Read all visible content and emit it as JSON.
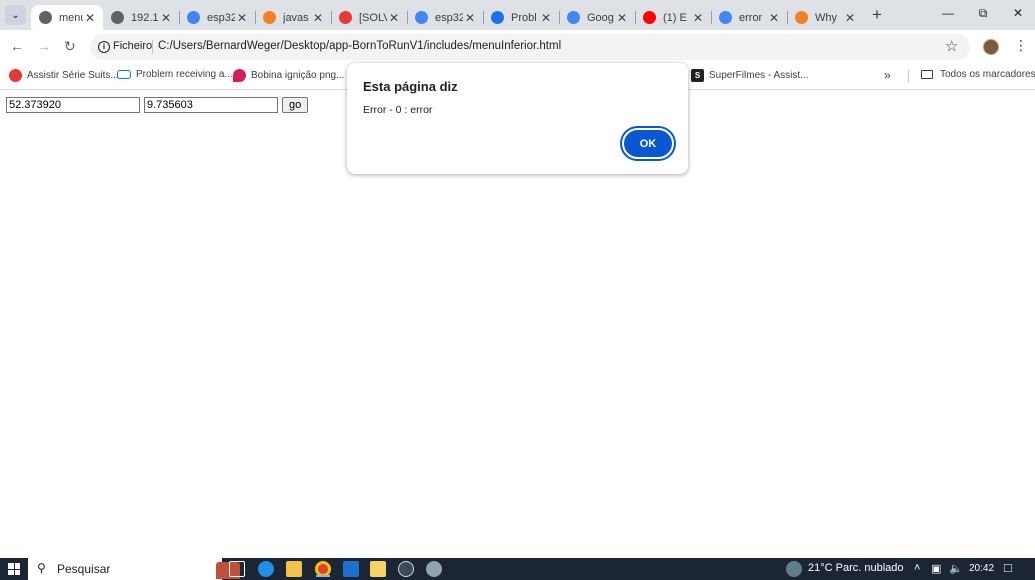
{
  "tabs": [
    {
      "title": "menu",
      "favicon": "globe-icon",
      "color": "#5f6368",
      "active": true
    },
    {
      "title": "192.1",
      "favicon": "globe-icon",
      "color": "#5f6368"
    },
    {
      "title": "esp32",
      "favicon": "google-icon",
      "color": "#4285f4"
    },
    {
      "title": "javas",
      "favicon": "stackoverflow-icon",
      "color": "#f48024"
    },
    {
      "title": "[SOLV",
      "favicon": "rss-icon",
      "color": "#e53935"
    },
    {
      "title": "esp32",
      "favicon": "google-icon",
      "color": "#4285f4"
    },
    {
      "title": "Probl",
      "favicon": "chain-icon",
      "color": "#1a73e8"
    },
    {
      "title": "Goog",
      "favicon": "translate-icon",
      "color": "#4285f4"
    },
    {
      "title": "(1) E",
      "favicon": "youtube-icon",
      "color": "#ff0000"
    },
    {
      "title": "error",
      "favicon": "google-icon",
      "color": "#4285f4"
    },
    {
      "title": "Why",
      "favicon": "stackoverflow-icon",
      "color": "#f48024"
    }
  ],
  "address": {
    "scheme_label": "Ficheiro",
    "url": "C:/Users/BernardWeger/Desktop/app-BornToRunV1/includes/menuInferior.html"
  },
  "bookmarks": [
    {
      "label": "Assistir Série Suits...",
      "color": "#e53935"
    },
    {
      "label": "Problem receiving a...",
      "color": "#1a73e8"
    },
    {
      "label": "Bobina ignição png...",
      "color": "#d81b60"
    },
    {
      "label": "SuperFilmes - Assist...",
      "color": "#202124"
    }
  ],
  "all_bookmarks_label": "Todos os marcadores",
  "form": {
    "lat": "52.373920",
    "lng": "9.735603",
    "go_label": "go"
  },
  "dialog": {
    "title": "Esta página diz",
    "message": "Error - 0 : error",
    "ok_label": "OK"
  },
  "taskbar": {
    "search_label": "Pesquisar",
    "weather": "21°C  Parc. nublado",
    "time": "20:42"
  }
}
